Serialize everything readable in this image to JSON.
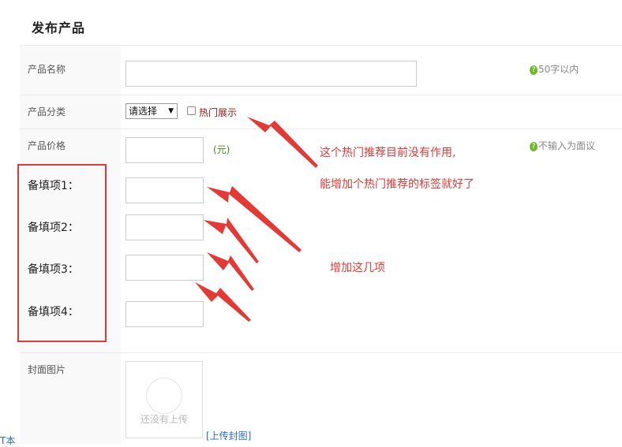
{
  "page_title": "发布产品",
  "fields": {
    "name": {
      "label": "产品名称",
      "hint": "50字以内"
    },
    "category": {
      "label": "产品分类",
      "select_value": "请选择",
      "checkbox_label": "热门展示"
    },
    "price": {
      "label": "产品价格",
      "unit": "(元)",
      "hint": "不输入为面议"
    },
    "extras": [
      {
        "label": "备填项1："
      },
      {
        "label": "备填项2："
      },
      {
        "label": "备填项3："
      },
      {
        "label": "备填项4："
      }
    ],
    "cover": {
      "label": "封面图片",
      "placeholder": "还没有上传",
      "upload_link": "[上传封图]"
    }
  },
  "annotations": {
    "note_line1": "这个热门推荐目前没有作用,",
    "note_line2": "能增加个热门推荐的标签就好了",
    "note_extras": "增加这几项",
    "color": "#e53935"
  },
  "edge_text": "T本",
  "icons": {
    "help": "question-icon",
    "arrow": "red-arrow-icon"
  }
}
